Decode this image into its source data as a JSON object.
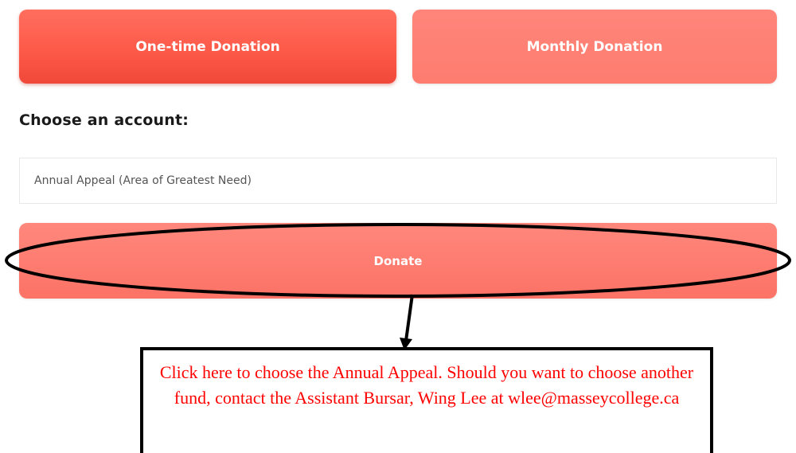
{
  "donation_type_tabs": [
    {
      "label": "One-time Donation"
    },
    {
      "label": "Monthly Donation"
    }
  ],
  "account_section": {
    "label": "Choose an account:",
    "selected_account": "Annual Appeal (Area of Greatest Need)"
  },
  "donate_button": {
    "label": "Donate"
  },
  "annotation": {
    "text": "Click here to choose the Annual Appeal.  Should you want to choose another fund, contact the Assistant Bursar, Wing Lee at wlee@masseycollege.ca"
  },
  "colors": {
    "primary_button": "#fd5a49",
    "secondary_button": "#fe7c70",
    "annotation_text": "#ff0000",
    "annotation_stroke": "#000000"
  }
}
